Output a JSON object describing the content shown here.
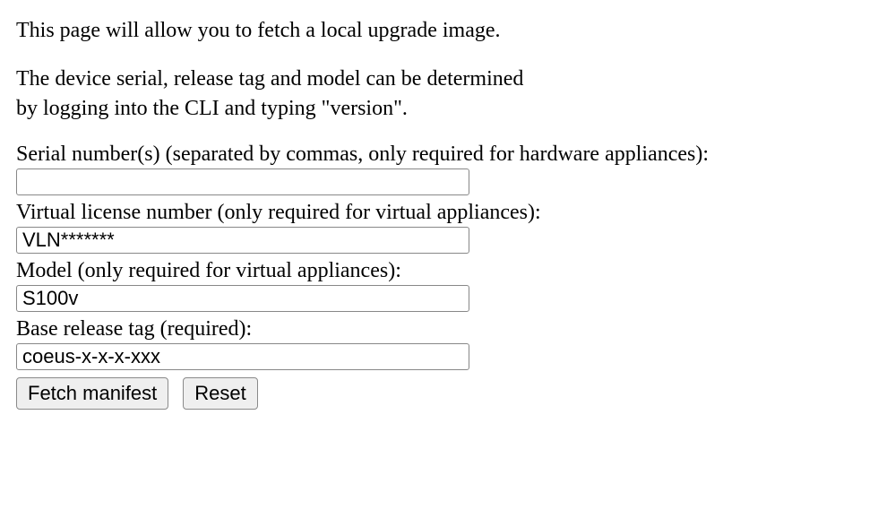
{
  "intro": {
    "line1": "This page will allow you to fetch a local upgrade image.",
    "line2": "The device serial, release tag and model can be determined\nby logging into the CLI and typing \"version\"."
  },
  "fields": {
    "serial": {
      "label": "Serial number(s) (separated by commas, only required for hardware appliances):",
      "value": ""
    },
    "vln": {
      "label": "Virtual license number (only required for virtual appliances):",
      "value": "VLN*******"
    },
    "model": {
      "label": "Model (only required for virtual appliances):",
      "value": "S100v"
    },
    "release": {
      "label": "Base release tag (required):",
      "value": "coeus-x-x-x-xxx"
    }
  },
  "buttons": {
    "fetch": "Fetch manifest",
    "reset": "Reset"
  }
}
